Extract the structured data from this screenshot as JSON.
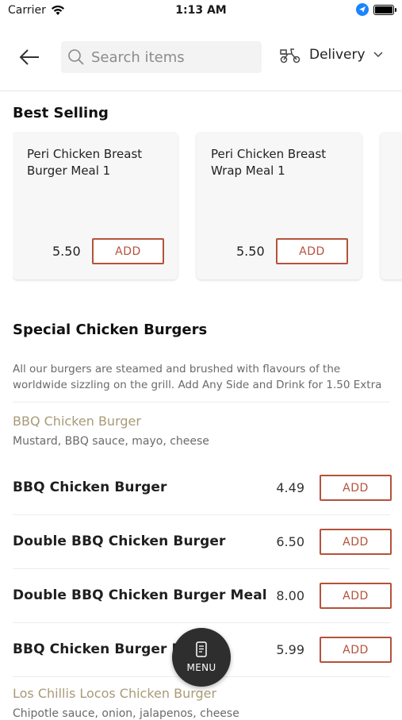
{
  "status_bar": {
    "carrier": "Carrier",
    "time": "1:13 AM"
  },
  "header": {
    "search_placeholder": "Search items",
    "delivery_label": "Delivery"
  },
  "best_selling": {
    "title": "Best Selling",
    "items": [
      {
        "name": "Peri Chicken Breast Burger Meal 1",
        "price": "5.50",
        "add_label": "ADD"
      },
      {
        "name": "Peri Chicken Breast Wrap Meal 1",
        "price": "5.50",
        "add_label": "ADD"
      }
    ]
  },
  "special": {
    "title": "Special Chicken Burgers",
    "description": "All our burgers are steamed and brushed with flavours of the worldwide sizzling on the grill. Add Any Side and Drink for 1.50 Extra",
    "subgroups": [
      {
        "name": "BBQ Chicken Burger",
        "description": "Mustard, BBQ sauce, mayo, cheese"
      },
      {
        "name": "Los Chillis Locos Chicken Burger",
        "description": "Chipotle sauce, onion, jalapenos, cheese"
      }
    ],
    "items": [
      {
        "name": "BBQ Chicken Burger",
        "price": "4.49",
        "add_label": "ADD"
      },
      {
        "name": "Double BBQ Chicken Burger",
        "price": "6.50",
        "add_label": "ADD"
      },
      {
        "name": "Double BBQ Chicken Burger Meal",
        "price": "8.00",
        "add_label": "ADD"
      },
      {
        "name": "BBQ Chicken Burger Meal",
        "price": "5.99",
        "add_label": "ADD"
      }
    ]
  },
  "menu_button": {
    "label": "MENU"
  },
  "colors": {
    "accent": "#b4523b",
    "subgroup": "#a99a77",
    "fab": "#2e2e2e"
  }
}
